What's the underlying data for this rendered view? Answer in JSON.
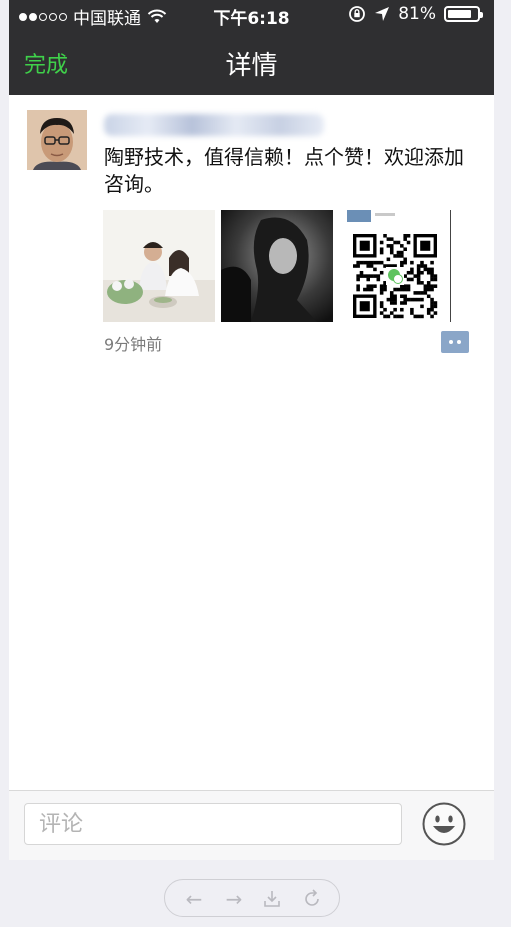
{
  "status_bar": {
    "carrier": "中国联通",
    "time": "下午6:18",
    "battery_percent": "81%",
    "battery_level": 0.81,
    "signal_bars_filled": 2,
    "signal_bars_total": 5
  },
  "nav": {
    "done_label": "完成",
    "title": "详情"
  },
  "post": {
    "text": "陶野技术，值得信赖！点个赞！欢迎添加咨询。",
    "time": "9分钟前",
    "photos": [
      "couple-photo",
      "woman-portrait-photo",
      "qr-code-photo"
    ]
  },
  "comment": {
    "placeholder": "评论"
  },
  "colors": {
    "accent_green": "#3fd14a",
    "nav_background": "#2f2f31",
    "comment_icon_blue": "#8aa6c8"
  },
  "browser_toolbar": {
    "icons": [
      "back-arrow-icon",
      "forward-arrow-icon",
      "download-icon",
      "refresh-icon"
    ]
  }
}
